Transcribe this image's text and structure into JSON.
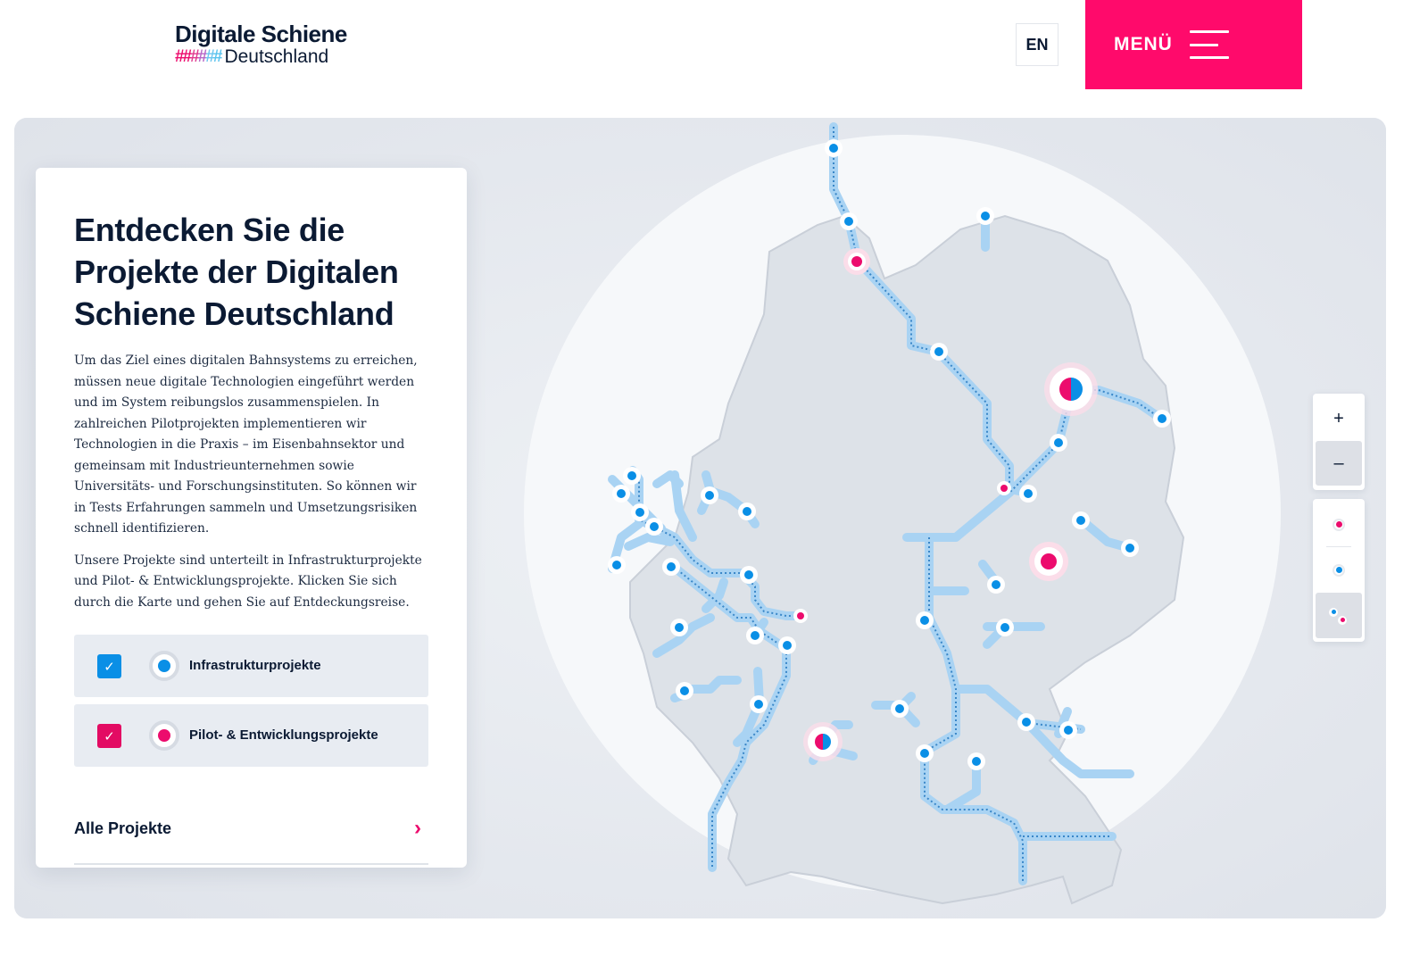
{
  "header": {
    "logo_title": "Digitale Schiene",
    "logo_subtitle": "Deutschland",
    "lang_button": "EN",
    "menu_label": "MENÜ"
  },
  "panel": {
    "title": "Entdecken Sie die Projekte der Digitalen Schiene Deutschland",
    "paragraph1": "Um das Ziel eines digitalen Bahnsystems zu erreichen, müssen neue digitale Technologien eingeführt werden und im System reibungslos zusammenspielen. In zahlreichen Pilotprojekten implementieren wir Technologien in die Praxis – im Eisenbahnsektor und gemeinsam mit Industrieunternehmen sowie Universitäts- und Forschungsinstituten. So können wir in Tests Erfahrungen sammeln und Umsetzungsrisiken schnell identifizieren.",
    "paragraph2": "Unsere Projekte sind unterteilt in Infrastrukturprojekte und Pilot- & Entwicklungsprojekte. Klicken Sie sich durch die Karte und gehen Sie auf Entdeckungsreise.",
    "filters": [
      {
        "label": "Infrastrukturprojekte",
        "checked": true,
        "color": "#0a8fe6",
        "checkbox_color": "#0a8fe6"
      },
      {
        "label": "Pilot- & Entwicklungsprojekte",
        "checked": true,
        "color": "#ec0c6d",
        "checkbox_color": "#e30b63"
      }
    ],
    "all_projects_link": "Alle Projekte"
  },
  "map_controls": {
    "zoom_in": "+",
    "zoom_out": "–",
    "view_options": [
      "pilot-projects-view",
      "infrastructure-projects-view",
      "all-projects-view"
    ],
    "selected_view": "all-projects-view"
  },
  "colors": {
    "brand_pink": "#ff0a6b",
    "infrastructure_blue": "#0a8fe6",
    "route_blue": "#a9d3f3",
    "text_dark": "#0b1a33"
  },
  "icons": {
    "checkbox": "check-icon",
    "arrow": "chevron-right-icon",
    "menu": "hamburger-icon"
  }
}
